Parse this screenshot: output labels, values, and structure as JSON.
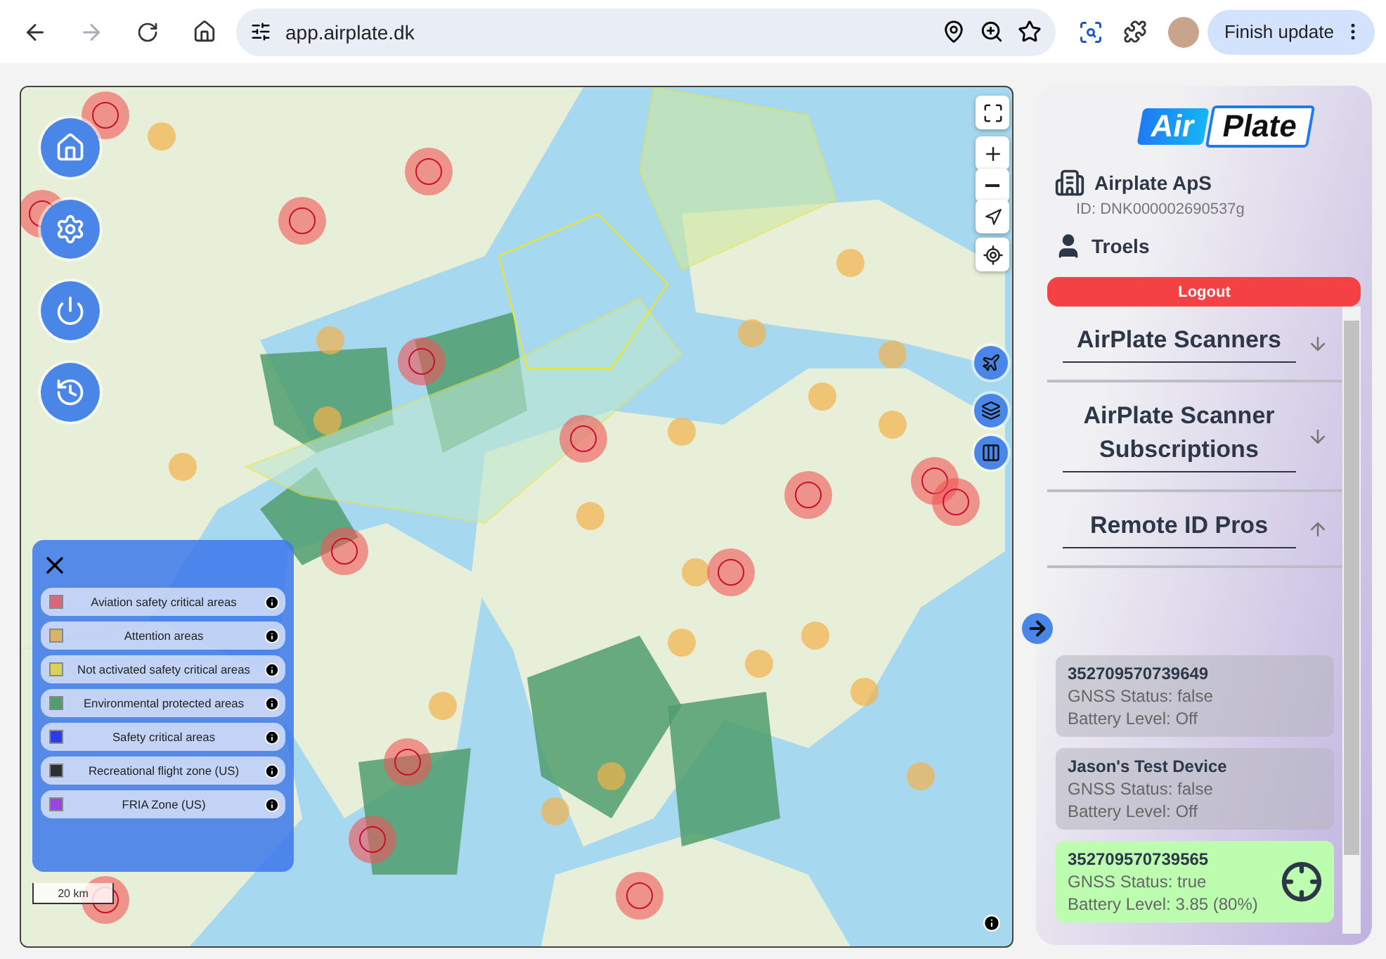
{
  "browser": {
    "url": "app.airplate.dk",
    "update_button": "Finish update"
  },
  "map": {
    "scale": "20 km",
    "legend": {
      "open": true,
      "items": [
        {
          "label": "Aviation safety critical areas",
          "color": "#d9677a"
        },
        {
          "label": "Attention areas",
          "color": "#d8b36a"
        },
        {
          "label": "Not activated safety critical areas",
          "color": "#d9d25a"
        },
        {
          "label": "Environmental protected areas",
          "color": "#4f9e6d"
        },
        {
          "label": "Safety critical areas",
          "color": "#2a3cf0"
        },
        {
          "label": "Recreational flight zone (US)",
          "color": "#2b3038"
        },
        {
          "label": "FRIA Zone (US)",
          "color": "#9a45e0"
        }
      ]
    }
  },
  "panel": {
    "logo": {
      "part_1": "Air",
      "part_2": "Plate"
    },
    "company": "Airplate ApS",
    "company_id": "ID: DNK000002690537g",
    "user": "Troels",
    "logout": "Logout",
    "sections": [
      {
        "title": "AirPlate Scanners",
        "expanded": false
      },
      {
        "title": "AirPlate Scanner Subscriptions",
        "expanded": false
      },
      {
        "title": "Remote ID Pros",
        "expanded": true
      }
    ],
    "devices": [
      {
        "name": "352709570739649",
        "gnss": "GNSS Status: false",
        "battery": "Battery Level: Off",
        "selected": false
      },
      {
        "name": "Jason's Test Device",
        "gnss": "GNSS Status: false",
        "battery": "Battery Level: Off",
        "selected": false
      },
      {
        "name": "352709570739565",
        "gnss": "GNSS Status: true",
        "battery": "Battery Level: 3.85 (80%)",
        "selected": true
      }
    ]
  }
}
